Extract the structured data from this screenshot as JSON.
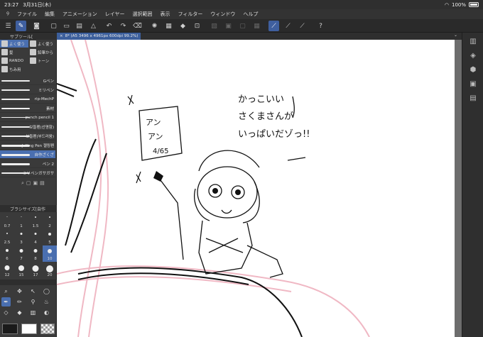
{
  "status": {
    "time": "23:27",
    "date": "3月31日(木)",
    "battery": "100%"
  },
  "menu": [
    "ファイル",
    "編集",
    "アニメーション",
    "レイヤー",
    "選択範囲",
    "表示",
    "フィルター",
    "ウィンドウ",
    "ヘルプ"
  ],
  "subtool_header": "サブツール[",
  "tools": [
    {
      "label": "よく使う",
      "col": 0,
      "row": 0,
      "sel": true
    },
    {
      "label": "よく使う",
      "col": 1,
      "row": 0,
      "sel": false
    },
    {
      "label": "髪",
      "col": 0,
      "row": 1,
      "sel": false
    },
    {
      "label": "鉛筆から",
      "col": 1,
      "row": 1,
      "sel": false
    },
    {
      "label": "RANDO",
      "col": 0,
      "row": 2,
      "sel": false
    },
    {
      "label": "トーン",
      "col": 1,
      "row": 2,
      "sel": false
    },
    {
      "label": "ちみ用",
      "col": 0,
      "row": 3,
      "sel": false
    }
  ],
  "brushes": [
    {
      "label": "Gペン",
      "sel": false
    },
    {
      "label": "ミリペン",
      "sel": false
    },
    {
      "label": "rip-MechP",
      "sel": false
    },
    {
      "label": "素材",
      "sel": false
    },
    {
      "label": "punch pencil 1",
      "sel": false
    },
    {
      "label": "보들펜(선명함)",
      "sel": false
    },
    {
      "label": "보들펜(부드러움)",
      "sel": false
    },
    {
      "label": "Jelling Pen 젤링펜",
      "sel": false
    },
    {
      "label": "自作ざくざ",
      "sel": true
    },
    {
      "label": "ペン 2",
      "sel": false
    },
    {
      "label": "ミリペンガサガサ",
      "sel": false
    }
  ],
  "brushsize_header": "ブラシサイズ[自作",
  "sizes": [
    {
      "v": "0.7",
      "sel": false
    },
    {
      "v": "1",
      "sel": false
    },
    {
      "v": "1.5",
      "sel": false
    },
    {
      "v": "2",
      "sel": false
    },
    {
      "v": "2.5",
      "sel": false
    },
    {
      "v": "3",
      "sel": false
    },
    {
      "v": "4",
      "sel": false
    },
    {
      "v": "5",
      "sel": false
    },
    {
      "v": "6",
      "sel": false
    },
    {
      "v": "7",
      "sel": false
    },
    {
      "v": "8",
      "sel": false
    },
    {
      "v": "10",
      "sel": true
    },
    {
      "v": "12",
      "sel": false
    },
    {
      "v": "15",
      "sel": false
    },
    {
      "v": "17",
      "sel": false
    },
    {
      "v": "20",
      "sel": false
    }
  ],
  "document_tab": "8* (A5 3496 x 4961px 600dpi 99.2%)",
  "drawing_text": {
    "line1": "かっこいい",
    "line2": "さくまさんが",
    "line3": "いっぱいだゾっ!!",
    "sign1": "アン",
    "sign2": "アン",
    "sign3": "4/65"
  },
  "colors": {
    "main": "#1a1a1a",
    "sub": "#ffffff",
    "accent": "#4a6fb0",
    "pink": "#f0b8c4"
  }
}
